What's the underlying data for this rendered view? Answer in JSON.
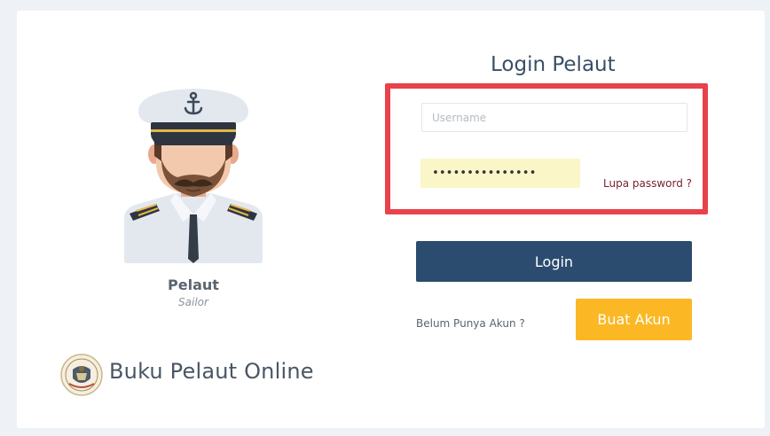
{
  "login": {
    "title": "Login Pelaut",
    "username_placeholder": "Username",
    "password_value": "•••••••••••••••",
    "forgot_label": "Lupa password ?",
    "login_label": "Login",
    "no_account_label": "Belum Punya Akun ?",
    "register_label": "Buat Akun"
  },
  "profile": {
    "name": "Pelaut",
    "role": "Sailor"
  },
  "brand": {
    "name": "Buku Pelaut Online"
  },
  "colors": {
    "primary": "#2b4c6f",
    "accent": "#fbb824",
    "highlight": "#e8424b",
    "autofill": "#fbf6c8"
  },
  "icons": {
    "avatar": "sailor-avatar",
    "logo": "emblem-logo"
  }
}
